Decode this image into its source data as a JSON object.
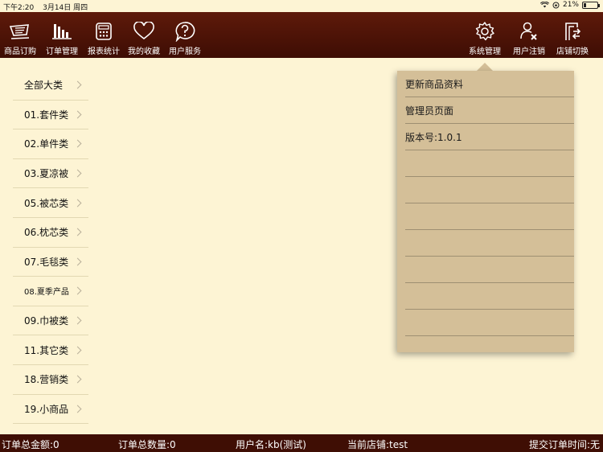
{
  "status_bar": {
    "time": "下午2:20",
    "date": "3月14日 周四",
    "battery": "21%",
    "battery_level": 0.21
  },
  "toolbar": {
    "left": [
      {
        "label": "商品订购",
        "icon": "cart-icon"
      },
      {
        "label": "订单管理",
        "icon": "bar-chart-icon"
      },
      {
        "label": "报表统计",
        "icon": "calculator-icon"
      },
      {
        "label": "我的收藏",
        "icon": "heart-icon"
      },
      {
        "label": "用户服务",
        "icon": "help-bubble-icon"
      }
    ],
    "right": [
      {
        "label": "系统管理",
        "icon": "gear-icon"
      },
      {
        "label": "用户注销",
        "icon": "user-logout-icon"
      },
      {
        "label": "店铺切换",
        "icon": "store-switch-icon"
      }
    ]
  },
  "categories": [
    {
      "label": "全部大类"
    },
    {
      "label": "01.套件类"
    },
    {
      "label": "02.单件类"
    },
    {
      "label": "03.夏凉被"
    },
    {
      "label": "05.被芯类"
    },
    {
      "label": "06.枕芯类"
    },
    {
      "label": "07.毛毯类"
    },
    {
      "label": "08.夏季产品"
    },
    {
      "label": "09.巾被类"
    },
    {
      "label": "11.其它类"
    },
    {
      "label": "18.营销类"
    },
    {
      "label": "19.小商品"
    }
  ],
  "system_menu": {
    "items": [
      "更新商品资料",
      "管理员页面",
      "版本号:1.0.1",
      "",
      "",
      "",
      "",
      "",
      "",
      "",
      ""
    ]
  },
  "footer": {
    "total_amount": "订单总金额:0",
    "total_qty": "订单总数量:0",
    "username": "用户名:kb(测试)",
    "current_store": "当前店铺:test",
    "submit_time": "提交订单时间:无"
  }
}
